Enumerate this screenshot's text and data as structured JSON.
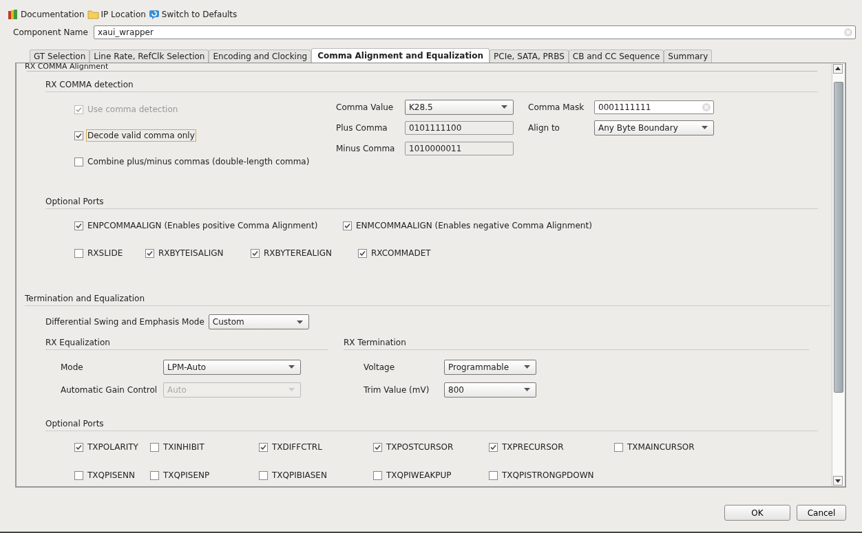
{
  "toolbar": [
    {
      "kind": "books",
      "label": "Documentation"
    },
    {
      "kind": "folder",
      "label": "IP Location"
    },
    {
      "kind": "refresh",
      "label": "Switch to Defaults"
    }
  ],
  "component_name": {
    "label": "Component Name",
    "value": "xaui_wrapper"
  },
  "tabs": [
    {
      "label": "GT Selection",
      "selected": false
    },
    {
      "label": "Line Rate, RefClk Selection",
      "selected": false
    },
    {
      "label": "Encoding and Clocking",
      "selected": false
    },
    {
      "label": "Comma Alignment and Equalization",
      "selected": true
    },
    {
      "label": "PCIe, SATA, PRBS",
      "selected": false
    },
    {
      "label": "CB and CC Sequence",
      "selected": false
    },
    {
      "label": "Summary",
      "selected": false
    }
  ],
  "section_title": "RX COMMA Alignment",
  "comma_detection": {
    "title": "RX COMMA detection",
    "options": [
      {
        "label": "Use comma detection",
        "checked": true,
        "disabled": true,
        "focused": false
      },
      {
        "label": "Decode valid comma only",
        "checked": true,
        "disabled": false,
        "focused": true
      },
      {
        "label": "Combine plus/minus commas (double-length comma)",
        "checked": false,
        "disabled": false,
        "focused": false
      }
    ],
    "fields": [
      {
        "label": "Comma Value",
        "value": "K28.5",
        "kind": "dropdown"
      },
      {
        "label": "Plus Comma",
        "value": "0101111100",
        "kind": "readonly"
      },
      {
        "label": "Minus Comma",
        "value": "1010000011",
        "kind": "readonly"
      }
    ],
    "fields_right": [
      {
        "label": "Comma Mask",
        "value": "0001111111",
        "kind": "text"
      },
      {
        "label": "Align to",
        "value": "Any Byte Boundary",
        "kind": "dropdown"
      }
    ]
  },
  "rx_optional_ports": {
    "title": "Optional Ports",
    "align_ports": [
      {
        "label": "ENPCOMMAALIGN (Enables positive Comma Alignment)",
        "checked": true
      },
      {
        "label": "ENMCOMMAALIGN (Enables negative Comma Alignment)",
        "checked": true
      }
    ],
    "status_ports": [
      {
        "label": "RXSLIDE",
        "checked": false
      },
      {
        "label": "RXBYTEISALIGN",
        "checked": true
      },
      {
        "label": "RXBYTEREALIGN",
        "checked": true
      },
      {
        "label": "RXCOMMADET",
        "checked": true
      }
    ]
  },
  "termination": {
    "title": "Termination and Equalization",
    "mode_label": "Differential Swing and Emphasis Mode",
    "mode_value": "Custom",
    "rx_equalization": {
      "title": "RX Equalization",
      "fields": [
        {
          "label": "Mode",
          "value": "LPM-Auto",
          "disabled": false
        },
        {
          "label": "Automatic Gain Control",
          "value": "Auto",
          "disabled": true
        }
      ]
    },
    "rx_termination": {
      "title": "RX Termination",
      "fields": [
        {
          "label": "Voltage",
          "value": "Programmable",
          "disabled": false
        },
        {
          "label": "Trim Value (mV)",
          "value": "800",
          "disabled": false
        }
      ]
    }
  },
  "tx_optional_ports": {
    "title": "Optional Ports",
    "rows": [
      [
        {
          "label": "TXPOLARITY",
          "checked": true
        },
        {
          "label": "TXINHIBIT",
          "checked": false
        },
        {
          "label": "TXDIFFCTRL",
          "checked": true
        },
        {
          "label": "TXPOSTCURSOR",
          "checked": true
        },
        {
          "label": "TXPRECURSOR",
          "checked": true
        },
        {
          "label": "TXMAINCURSOR",
          "checked": false
        }
      ],
      [
        {
          "label": "TXQPISENN",
          "checked": false
        },
        {
          "label": "TXQPISENP",
          "checked": false
        },
        {
          "label": "TXQPIBIASEN",
          "checked": false
        },
        {
          "label": "TXQPIWEAKPUP",
          "checked": false
        },
        {
          "label": "TXQPISTRONGPDOWN",
          "checked": false
        }
      ]
    ]
  },
  "buttons": [
    "OK",
    "Cancel"
  ]
}
